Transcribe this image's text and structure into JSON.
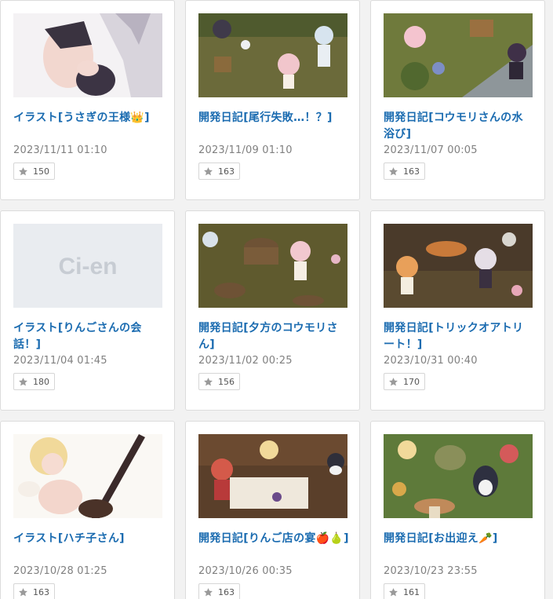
{
  "posts": [
    {
      "title": "イラスト[うさぎの王様👑]",
      "date": "2023/11/11 01:10",
      "likes": "150",
      "thumb": "illustration-thumbnail"
    },
    {
      "title": "開発日記[尾行失敗…！？]",
      "date": "2023/11/09 01:10",
      "likes": "163",
      "thumb": "game-scene-thumbnail"
    },
    {
      "title": "開発日記[コウモリさんの水浴び]",
      "date": "2023/11/07 00:05",
      "likes": "163",
      "thumb": "game-scene-thumbnail"
    },
    {
      "title": "イラスト[りんごさんの会話！]",
      "date": "2023/11/04 01:45",
      "likes": "180",
      "thumb": "ci-en-placeholder",
      "placeholder_text": "Ci-en"
    },
    {
      "title": "開発日記[夕方のコウモリさん]",
      "date": "2023/11/02 00:25",
      "likes": "156",
      "thumb": "game-scene-thumbnail"
    },
    {
      "title": "開発日記[トリックオアトリート！]",
      "date": "2023/10/31 00:40",
      "likes": "170",
      "thumb": "game-scene-thumbnail"
    },
    {
      "title": "イラスト[ハチ子さん]",
      "date": "2023/10/28 01:25",
      "likes": "163",
      "thumb": "illustration-thumbnail"
    },
    {
      "title": "開発日記[りんご店の宴🍎🍐]",
      "date": "2023/10/26 00:35",
      "likes": "163",
      "thumb": "game-scene-thumbnail"
    },
    {
      "title": "開発日記[お出迎え🥕]",
      "date": "2023/10/23 23:55",
      "likes": "161",
      "thumb": "game-scene-thumbnail"
    }
  ],
  "icons": {
    "like": "star-icon"
  },
  "colors": {
    "title": "#1a6bb0",
    "date": "#808080",
    "star": "#9a9a9a"
  }
}
